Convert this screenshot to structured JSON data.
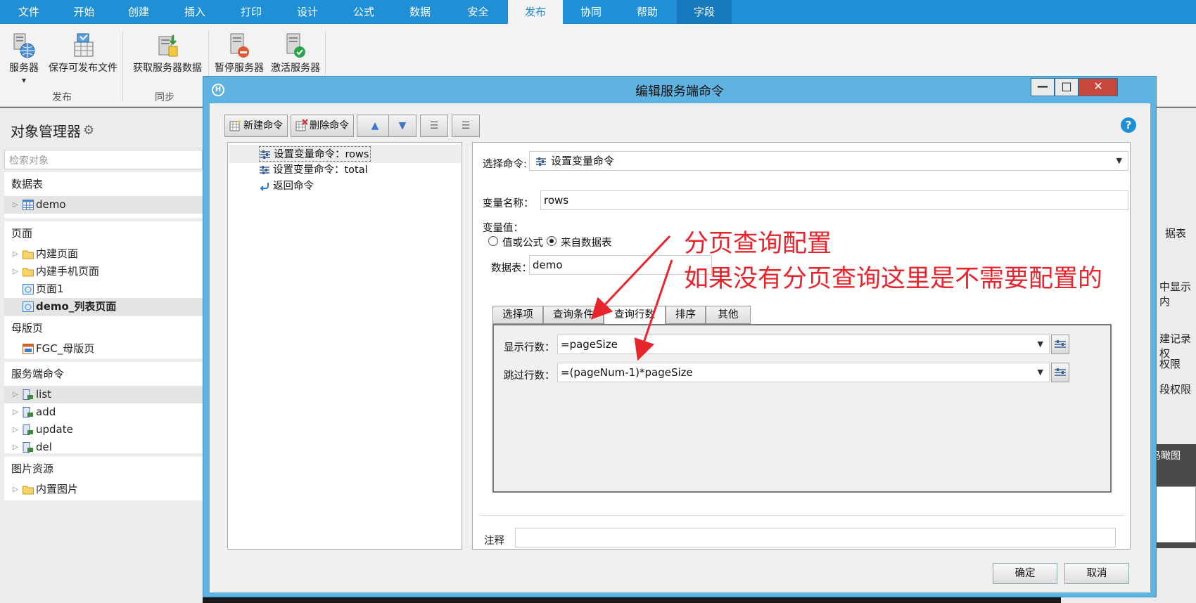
{
  "menubar": {
    "tabs": [
      "文件",
      "开始",
      "创建",
      "插入",
      "打印",
      "设计",
      "公式",
      "数据",
      "安全",
      "发布",
      "协同",
      "帮助",
      "字段"
    ],
    "active_tab": "发布"
  },
  "ribbon": {
    "buttons": {
      "server": "服务器",
      "save_publishable": "保存可发布文件",
      "get_server_data": "获取服务器数据",
      "pause_server": "暂停服务器",
      "activate_server": "激活服务器"
    },
    "groups": {
      "publish": "发布",
      "sync": "同步"
    }
  },
  "object_manager": {
    "title": "对象管理器",
    "search_placeholder": "检索对象",
    "sections": {
      "tables": {
        "title": "数据表",
        "items": [
          "demo"
        ]
      },
      "pages": {
        "title": "页面",
        "items": [
          "内建页面",
          "内建手机页面",
          "页面1",
          "demo_列表页面"
        ]
      },
      "master": {
        "title": "母版页",
        "items": [
          "FGC_母版页"
        ]
      },
      "server_commands": {
        "title": "服务端命令",
        "items": [
          "list",
          "add",
          "update",
          "del"
        ]
      },
      "images": {
        "title": "图片资源",
        "items": [
          "内置图片"
        ]
      }
    }
  },
  "right_panel": {
    "fragments": [
      "据表",
      "中显示内",
      "建记录权",
      "权限",
      "段权限"
    ],
    "birdseye": "鸟瞰图"
  },
  "dialog": {
    "title": "编辑服务端命令",
    "toolbar": {
      "new_command": "新建命令",
      "delete_command": "删除命令"
    },
    "tree": {
      "items": [
        "设置变量命令：rows",
        "设置变量命令：total",
        "返回命令"
      ]
    },
    "props": {
      "select_command_label": "选择命令:",
      "select_command_value": "设置变量命令",
      "var_name_label": "变量名称：",
      "var_name_value": "rows",
      "var_value_label": "变量值：",
      "radio_formula": "值或公式",
      "radio_table": "来自数据表",
      "table_label": "数据表：",
      "table_value": "demo",
      "subtabs": [
        "选择项",
        "查询条件",
        "查询行数",
        "排序",
        "其他"
      ],
      "active_subtab": "查询行数",
      "show_rows_label": "显示行数：",
      "show_rows_value": "=pageSize",
      "skip_rows_label": "跳过行数：",
      "skip_rows_value": "=(pageNum-1)*pageSize",
      "note_label": "注释"
    },
    "ok": "确定",
    "cancel": "取消"
  },
  "annotation": {
    "line1": "分页查询配置",
    "line2": "如果没有分页查询这里是不需要配置的",
    "color": "#e8252d"
  }
}
